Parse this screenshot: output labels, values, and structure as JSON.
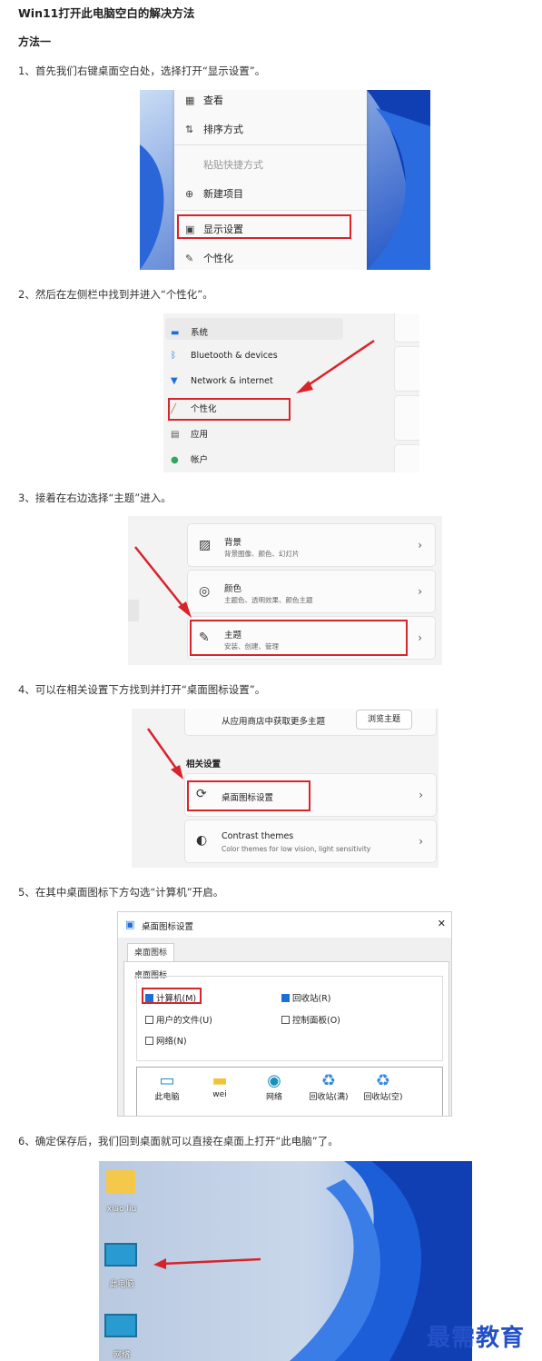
{
  "article": {
    "title": "Win11打开此电脑空白的解决方法",
    "method": "方法一",
    "steps": [
      "1、首先我们右键桌面空白处，选择打开“显示设置”。",
      "2、然后在左侧栏中找到并进入“个性化”。",
      "3、接着在右边选择“主题”进入。",
      "4、可以在相关设置下方找到并打开“桌面图标设置”。",
      "5、在其中桌面图标下方勾选“计算机”开启。",
      "6、确定保存后，我们回到桌面就可以直接在桌面上打开“此电脑”了。"
    ]
  },
  "context_menu": {
    "items": [
      {
        "icon": "view-icon",
        "label": "查看"
      },
      {
        "icon": "sort-icon",
        "label": "排序方式"
      },
      {
        "icon": "",
        "label": "粘贴快捷方式"
      },
      {
        "icon": "new-item-icon",
        "label": "新建项目"
      },
      {
        "icon": "display-settings-icon",
        "label": "显示设置"
      },
      {
        "icon": "personalize-icon",
        "label": "个性化"
      }
    ]
  },
  "settings_nav": {
    "items": [
      {
        "icon": "system-icon",
        "label": "系统"
      },
      {
        "icon": "bluetooth-icon",
        "label": "Bluetooth & devices"
      },
      {
        "icon": "network-icon",
        "label": "Network & internet"
      },
      {
        "icon": "brush-icon",
        "label": "个性化"
      },
      {
        "icon": "apps-icon",
        "label": "应用"
      },
      {
        "icon": "account-icon",
        "label": "帐户"
      }
    ]
  },
  "personalization_cards": [
    {
      "icon": "image-icon",
      "title": "背景",
      "subtitle": "背景图像、颜色、幻灯片"
    },
    {
      "icon": "palette-icon",
      "title": "颜色",
      "subtitle": "主题色、透明效果、颜色主题"
    },
    {
      "icon": "brush-icon",
      "title": "主题",
      "subtitle": "安装、创建、管理"
    }
  ],
  "themes_page": {
    "store_text": "从应用商店中获取更多主题",
    "browse_button": "浏览主题",
    "related_heading": "相关设置",
    "desktop_icon_settings": "桌面图标设置",
    "contrast_title": "Contrast themes",
    "contrast_subtitle": "Color themes for low vision, light sensitivity"
  },
  "desktop_icon_dialog": {
    "title": "桌面图标设置",
    "close": "✕",
    "tab": "桌面图标",
    "group": "桌面图标",
    "checkboxes": [
      {
        "label": "计算机(M)",
        "checked": true
      },
      {
        "label": "回收站(R)",
        "checked": true
      },
      {
        "label": "用户的文件(U)",
        "checked": false
      },
      {
        "label": "控制面板(O)",
        "checked": false
      },
      {
        "label": "网络(N)",
        "checked": false
      }
    ],
    "icons": [
      "此电脑",
      "wei",
      "网络",
      "回收站(满)",
      "回收站(空)"
    ]
  },
  "desktop": {
    "icons": [
      "xiao liu",
      "此电脑",
      "网络"
    ]
  },
  "watermark": "最需教育",
  "colors": {
    "highlight_red": "#d8232a",
    "win_blue": "#1d6fd8"
  }
}
